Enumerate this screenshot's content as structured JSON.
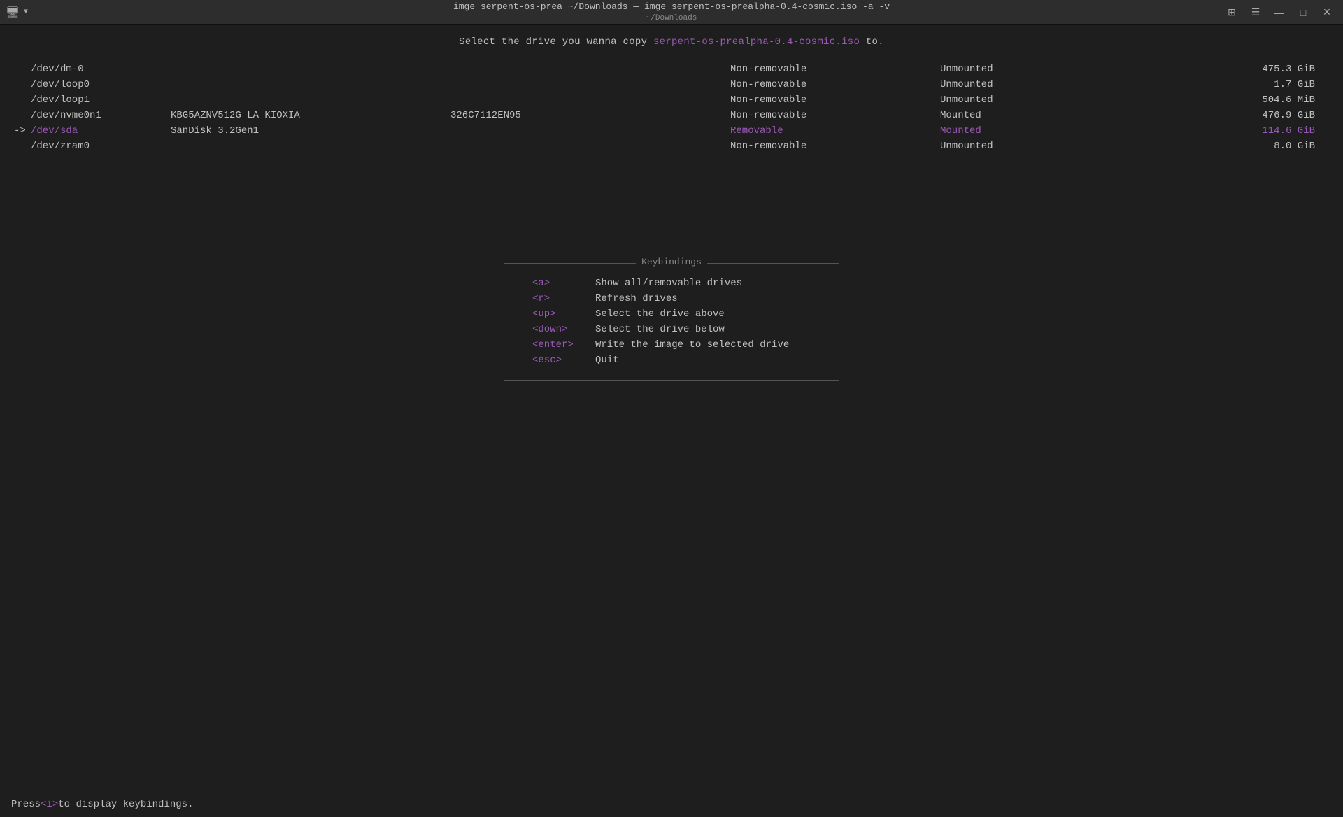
{
  "titlebar": {
    "title": "imge serpent-os-prea ~/Downloads — imge serpent-os-prealpha-0.4-cosmic.iso -a -v",
    "subtitle": "~/Downloads",
    "icon": "🖥",
    "dropdown_icon": "▼",
    "controls": {
      "grid": "⊞",
      "menu": "☰",
      "minimize": "—",
      "maximize": "□",
      "close": "✕"
    }
  },
  "instruction": {
    "prefix": "Select the drive you wanna copy ",
    "iso": "serpent-os-prealpha-0.4-cosmic.iso",
    "suffix": " to."
  },
  "drives": [
    {
      "arrow": "",
      "device": "/dev/dm-0",
      "model": "",
      "serial": "",
      "removable": "Non-removable",
      "mount": "Unmounted",
      "size": "475.3 GiB",
      "selected": false,
      "device_highlight": false,
      "removable_highlight": false,
      "mount_highlight": false,
      "size_highlight": false
    },
    {
      "arrow": "",
      "device": "/dev/loop0",
      "model": "",
      "serial": "",
      "removable": "Non-removable",
      "mount": "Unmounted",
      "size": "1.7 GiB",
      "selected": false,
      "device_highlight": false,
      "removable_highlight": false,
      "mount_highlight": false,
      "size_highlight": false
    },
    {
      "arrow": "",
      "device": "/dev/loop1",
      "model": "",
      "serial": "",
      "removable": "Non-removable",
      "mount": "Unmounted",
      "size": "504.6 MiB",
      "selected": false,
      "device_highlight": false,
      "removable_highlight": false,
      "mount_highlight": false,
      "size_highlight": false
    },
    {
      "arrow": "",
      "device": "/dev/nvme0n1",
      "model": "KBG5AZNV512G LA KIOXIA",
      "serial": "326C7112EN95",
      "removable": "Non-removable",
      "mount": "Mounted",
      "size": "476.9 GiB",
      "selected": false,
      "device_highlight": false,
      "removable_highlight": false,
      "mount_highlight": false,
      "size_highlight": false
    },
    {
      "arrow": "->",
      "device": "/dev/sda",
      "model": "SanDisk 3.2Gen1",
      "serial": "",
      "removable": "Removable",
      "mount": "Mounted",
      "size": "114.6 GiB",
      "selected": true,
      "device_highlight": true,
      "removable_highlight": true,
      "mount_highlight": true,
      "size_highlight": true
    },
    {
      "arrow": "",
      "device": "/dev/zram0",
      "model": "",
      "serial": "",
      "removable": "Non-removable",
      "mount": "Unmounted",
      "size": "8.0 GiB",
      "selected": false,
      "device_highlight": false,
      "removable_highlight": false,
      "mount_highlight": false,
      "size_highlight": false
    }
  ],
  "keybindings": {
    "title": "Keybindings",
    "items": [
      {
        "key": "<a>",
        "description": "Show all/removable drives"
      },
      {
        "key": "<r>",
        "description": "Refresh drives"
      },
      {
        "key": "<up>",
        "description": "Select the drive above"
      },
      {
        "key": "<down>",
        "description": "Select the drive below"
      },
      {
        "key": "<enter>",
        "description": "Write the image to selected drive"
      },
      {
        "key": "<esc>",
        "description": "Quit"
      }
    ]
  },
  "statusbar": {
    "prefix": "Press ",
    "key": "<i>",
    "suffix": " to display keybindings."
  }
}
